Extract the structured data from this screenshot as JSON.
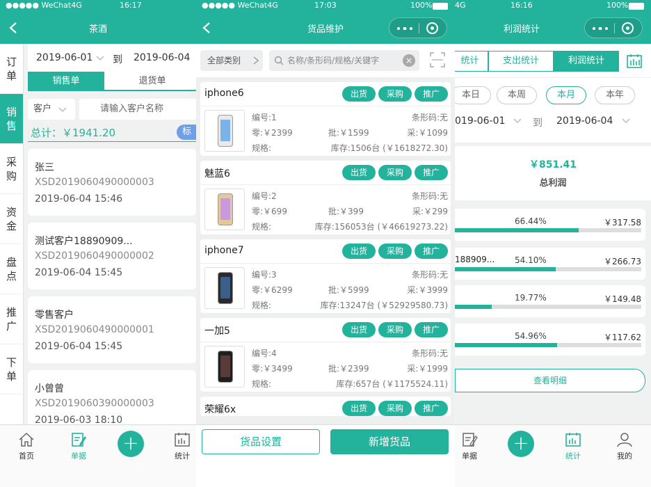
{
  "screen1": {
    "status": {
      "carrier": "●●●●● WeChat4G",
      "time": "16:17"
    },
    "title": "茶酒",
    "side_menu": [
      {
        "label": "订单",
        "active": false
      },
      {
        "label": "销售",
        "active": true
      },
      {
        "label": "采购",
        "active": false
      },
      {
        "label": "资金",
        "active": false
      },
      {
        "label": "盘点",
        "active": false
      },
      {
        "label": "推广",
        "active": false
      },
      {
        "label": "下单",
        "active": false
      }
    ],
    "date_from": "2019-06-01",
    "to_label": "到",
    "date_to": "2019-06-04",
    "tabs": {
      "sales": "销售单",
      "returns": "退货单"
    },
    "customer_select": "客户",
    "customer_placeholder": "请输入客户名称",
    "total": "总计：￥1941.20",
    "badge": "标",
    "orders": [
      {
        "name": "张三",
        "no": "XSD2019060490000003",
        "time": "2019-06-04 15:46"
      },
      {
        "name": "测试客户18890909...",
        "no": "XSD2019060490000002",
        "time": "2019-06-04 15:45"
      },
      {
        "name": "零售客户",
        "no": "XSD2019060490000001",
        "time": "2019-06-04 15:45"
      },
      {
        "name": "小曾曾",
        "no": "XSD2019060390000003",
        "time": "2019-06-03 18:10"
      }
    ],
    "tabbar": {
      "home": "首页",
      "docs": "单据",
      "stats": "统计"
    }
  },
  "screen2": {
    "status": {
      "carrier": "●●●●● WeChat4G",
      "time": "17:03",
      "battery": "100%"
    },
    "title": "货品维护",
    "category": "全部类别",
    "search_placeholder": "名称/条形码/规格/关键字",
    "action_labels": {
      "ship": "出货",
      "purchase": "采购",
      "promote": "推广"
    },
    "products": [
      {
        "name": "iphone6",
        "code": "编号:1",
        "barcode": "条形码:无",
        "retail": "零:￥2399",
        "wholesale": "批:￥1599",
        "purchase": "采:￥1099",
        "spec": "规格:",
        "stock": "库存:1506台 (￥1618272.30)",
        "phone_color": "#e9e9e9",
        "screen_color": "#7ab3e8"
      },
      {
        "name": "魅蓝6",
        "code": "编号:2",
        "barcode": "条形码:无",
        "retail": "零:￥699",
        "wholesale": "批:￥399",
        "purchase": "采:￥299",
        "spec": "规格:",
        "stock": "库存:156053台 (￥46619273.22)",
        "phone_color": "#e4c89c",
        "screen_color": "#c79ae0"
      },
      {
        "name": "iphone7",
        "code": "编号:3",
        "barcode": "条形码:无",
        "retail": "零:￥6299",
        "wholesale": "批:￥5999",
        "purchase": "采:￥3999",
        "spec": "规格:",
        "stock": "库存:13247台 (￥52929580.73)",
        "phone_color": "#2a2a2a",
        "screen_color": "#3a5f8a"
      },
      {
        "name": "一加5",
        "code": "编号:4",
        "barcode": "条形码:无",
        "retail": "零:￥3499",
        "wholesale": "批:￥2399",
        "purchase": "采:￥1999",
        "spec": "规格:",
        "stock": "库存:657台 (￥1175524.11)",
        "phone_color": "#1f1f1f",
        "screen_color": "#5b3a3a"
      },
      {
        "name": "荣耀6x"
      }
    ],
    "settings_btn": "货品设置",
    "add_btn": "新增货品"
  },
  "screen3": {
    "status": {
      "carrier": "4G",
      "time": "16:16",
      "battery": "100%"
    },
    "title": "利润统计",
    "segments": {
      "income": "统计",
      "expense": "支出统计",
      "profit": "利润统计"
    },
    "periods": {
      "day": "本日",
      "week": "本周",
      "month": "本月",
      "year": "本年"
    },
    "date_from": "019-06-01",
    "to_label": "到",
    "date_to": "2019-06-04",
    "total_profit": "￥851.41",
    "total_profit_label": "总利润",
    "rows": [
      {
        "name": "",
        "pct": "66.44%",
        "fill": 0.6644,
        "amount": "￥317.58"
      },
      {
        "name": "188909...",
        "pct": "54.10%",
        "fill": 0.541,
        "amount": "￥266.73"
      },
      {
        "name": "",
        "pct": "19.77%",
        "fill": 0.1977,
        "amount": "￥149.48"
      },
      {
        "name": "",
        "pct": "54.96%",
        "fill": 0.5496,
        "amount": "￥117.62"
      }
    ],
    "detail_btn": "查看明细",
    "tabbar": {
      "docs": "单据",
      "stats": "统计",
      "mine": "我的"
    }
  }
}
